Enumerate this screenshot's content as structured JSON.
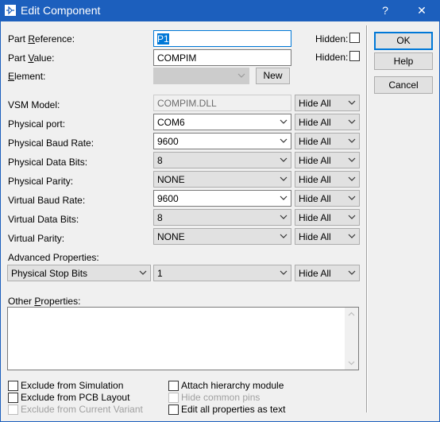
{
  "window": {
    "title": "Edit Component",
    "help_label": "?",
    "close_label": "✕"
  },
  "fields": {
    "part_reference": {
      "label_pre": "Part ",
      "label_ul": "R",
      "label_post": "eference:",
      "value": "P1",
      "hidden_label": "Hidden:"
    },
    "part_value": {
      "label_pre": "Part ",
      "label_ul": "V",
      "label_post": "alue:",
      "value": "COMPIM",
      "hidden_label": "Hidden:"
    },
    "element": {
      "label_ul": "E",
      "label_post": "lement:",
      "value": "",
      "new_label": "New"
    }
  },
  "properties": [
    {
      "label": "VSM Model:",
      "value": "COMPIM.DLL",
      "visibility": "Hide All"
    },
    {
      "label": "Physical port:",
      "value": "COM6",
      "visibility": "Hide All"
    },
    {
      "label": "Physical Baud Rate:",
      "value": "9600",
      "visibility": "Hide All"
    },
    {
      "label": "Physical Data Bits:",
      "value": "8",
      "visibility": "Hide All"
    },
    {
      "label": "Physical Parity:",
      "value": "NONE",
      "visibility": "Hide All"
    },
    {
      "label": "Virtual Baud Rate:",
      "value": "9600",
      "visibility": "Hide All"
    },
    {
      "label": "Virtual Data Bits:",
      "value": "8",
      "visibility": "Hide All"
    },
    {
      "label": "Virtual Parity:",
      "value": "NONE",
      "visibility": "Hide All"
    }
  ],
  "advanced": {
    "label": "Advanced Properties:",
    "property": "Physical Stop Bits",
    "value": "1",
    "visibility": "Hide All"
  },
  "other": {
    "label_pre": "Other ",
    "label_ul": "P",
    "label_post": "roperties:",
    "text": ""
  },
  "options": {
    "exclude_simulation": "Exclude from Simulation",
    "exclude_pcb": "Exclude from PCB Layout",
    "exclude_variant": "Exclude from Current Variant",
    "attach_hierarchy": "Attach hierarchy module",
    "hide_common_pins": "Hide common pins",
    "edit_all_text": "Edit all properties as text"
  },
  "buttons": {
    "ok": "OK",
    "help": "Help",
    "cancel": "Cancel"
  },
  "colors": {
    "titlebar": "#1c5fbd",
    "focus": "#0078d7"
  }
}
